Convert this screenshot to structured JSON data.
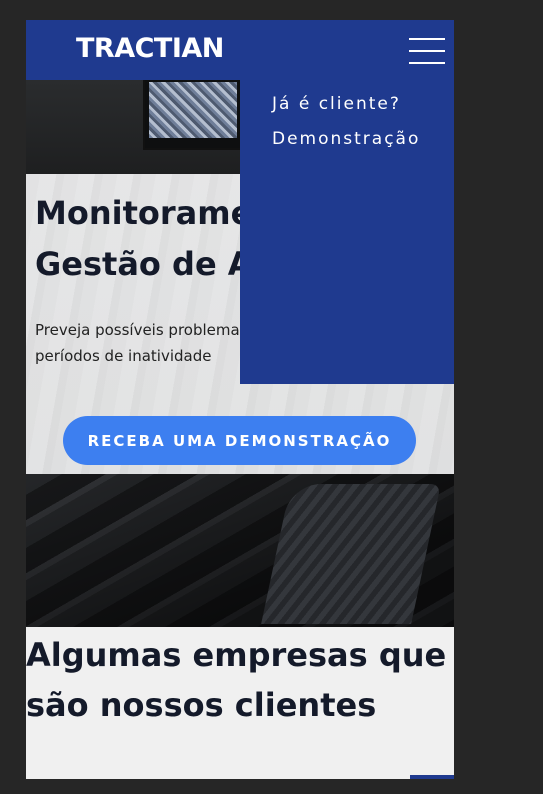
{
  "brand": {
    "logo_text": "TRACTIAN",
    "primary_color": "#1f3a8f",
    "accent_color": "#3d7ff0"
  },
  "header": {
    "menu_icon": "hamburger-icon"
  },
  "menu": {
    "items": [
      {
        "label": "Já é cliente?"
      },
      {
        "label": "Demonstração"
      }
    ]
  },
  "hero": {
    "title_line1": "Monitoramento e",
    "title_line2": "Gestão de Ativos",
    "text_line1": "Preveja possíveis problemas e evite",
    "text_line2": "períodos de inatividade",
    "cta_label": "RECEBA UMA DEMONSTRAÇÃO"
  },
  "clients": {
    "title_line1": "Algumas empresas que",
    "title_line2": "são nossos clientes"
  }
}
